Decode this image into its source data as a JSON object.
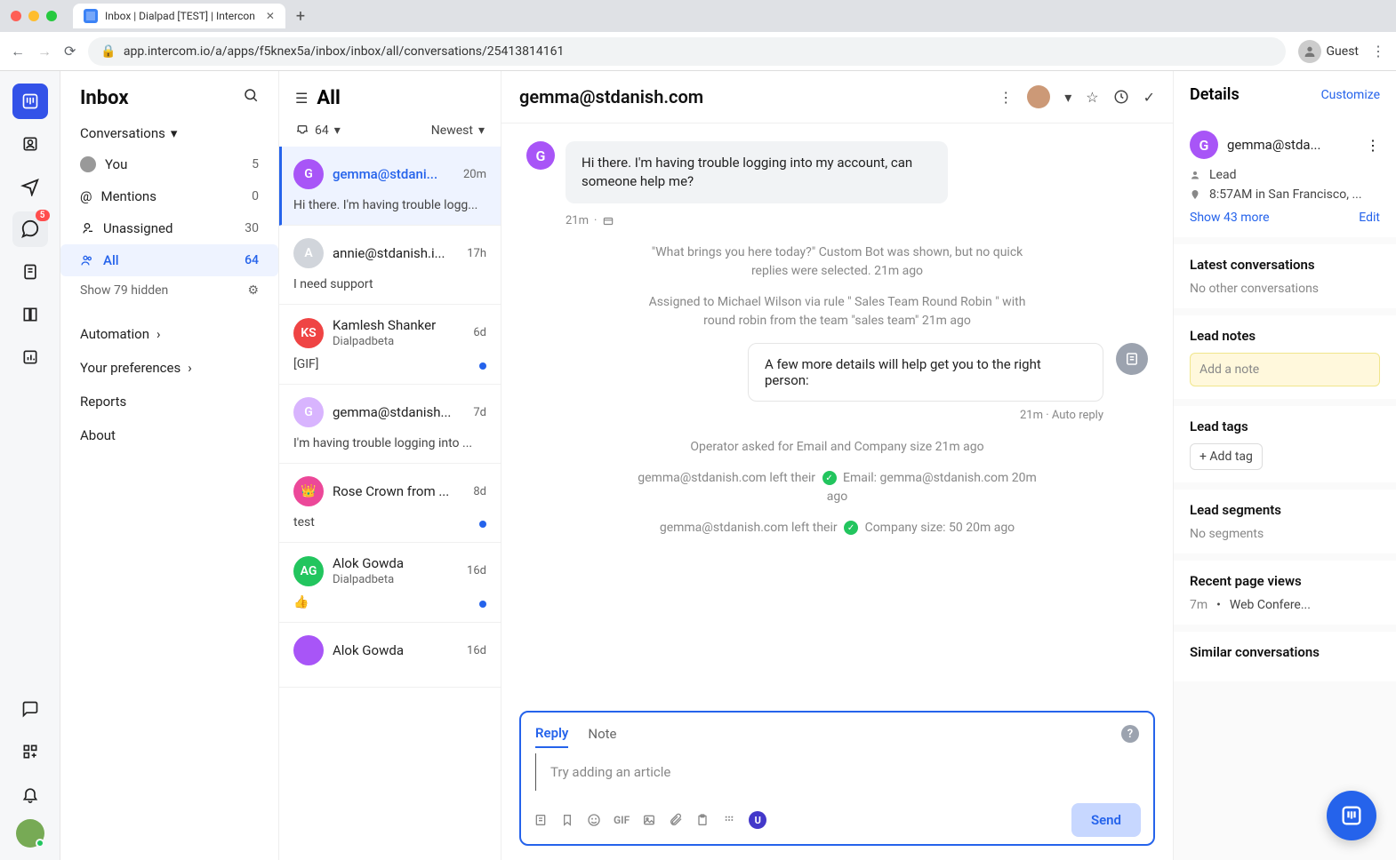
{
  "browser": {
    "tab_title": "Inbox | Dialpad [TEST] | Intercon",
    "url_display": "app.intercom.io/a/apps/f5knex5a/inbox/inbox/all/conversations/25413814161",
    "guest_label": "Guest"
  },
  "sidebar": {
    "title": "Inbox",
    "conversations_label": "Conversations",
    "filters": [
      {
        "label": "You",
        "count": "5"
      },
      {
        "label": "Mentions",
        "count": "0"
      },
      {
        "label": "Unassigned",
        "count": "30"
      },
      {
        "label": "All",
        "count": "64",
        "selected": true
      }
    ],
    "show_hidden": "Show 79 hidden",
    "rail_badge": "5",
    "links": {
      "automation": "Automation",
      "preferences": "Your preferences",
      "reports": "Reports",
      "about": "About"
    }
  },
  "conv_list": {
    "title": "All",
    "open_count": "64",
    "sort": "Newest",
    "items": [
      {
        "avatar": "G",
        "color": "#a855f7",
        "title": "gemma@stdani...",
        "time": "20m",
        "preview": "Hi there. I'm having trouble logg...",
        "selected": true
      },
      {
        "avatar": "A",
        "color": "#d1d5db",
        "title": "annie@stdanish.i...",
        "time": "17h",
        "preview": "I need support"
      },
      {
        "avatar": "KS",
        "color": "#ef4444",
        "title": "Kamlesh Shanker",
        "sub": "Dialpadbeta",
        "time": "6d",
        "preview": "[GIF]",
        "unread": true
      },
      {
        "avatar": "G",
        "color": "#d8b4fe",
        "title": "gemma@stdanish...",
        "time": "7d",
        "preview": "I'm having trouble logging into ..."
      },
      {
        "avatar": "👑",
        "color": "#ec4899",
        "title": "Rose Crown from ...",
        "time": "8d",
        "preview": "test",
        "unread": true
      },
      {
        "avatar": "AG",
        "color": "#22c55e",
        "title": "Alok Gowda",
        "sub": "Dialpadbeta",
        "time": "16d",
        "preview": "👍",
        "unread": true
      },
      {
        "avatar": "",
        "color": "#a855f7",
        "title": "Alok Gowda",
        "time": "16d",
        "preview": ""
      }
    ]
  },
  "conversation": {
    "title": "gemma@stdanish.com",
    "first_message": "Hi there. I'm having trouble logging into my account, can someone help me?",
    "first_meta": "21m",
    "sys1": "\"What brings you here today?\" Custom Bot was shown, but no quick replies were selected. 21m ago",
    "sys2": "Assigned to Michael Wilson via rule \" Sales Team Round Robin \" with round robin from the team \"sales team\" 21m ago",
    "auto_reply": "A few more details will help get you to the right person:",
    "auto_reply_meta": "21m · Auto reply",
    "sys3": "Operator asked for Email and Company size 21m ago",
    "sys4_pre": "gemma@stdanish.com left their",
    "sys4_post": "Email: gemma@stdanish.com 20m ago",
    "sys5_pre": "gemma@stdanish.com left their",
    "sys5_post": "Company size: 50 20m ago"
  },
  "composer": {
    "tabs": {
      "reply": "Reply",
      "note": "Note"
    },
    "placeholder": "Try adding an article",
    "send": "Send",
    "gif_label": "GIF"
  },
  "details": {
    "title": "Details",
    "customize": "Customize",
    "contact_email": "gemma@stda...",
    "contact_type": "Lead",
    "contact_loc": "8:57AM in San Francisco, ...",
    "show_more": "Show 43 more",
    "edit": "Edit",
    "latest_title": "Latest conversations",
    "latest_empty": "No other conversations",
    "notes_title": "Lead notes",
    "notes_placeholder": "Add a note",
    "tags_title": "Lead tags",
    "add_tag": "+ Add tag",
    "segments_title": "Lead segments",
    "segments_empty": "No segments",
    "pageviews_title": "Recent page views",
    "pv_time": "7m",
    "pv_sep": "•",
    "pv_page": "Web Confere...",
    "similar_title": "Similar conversations"
  }
}
